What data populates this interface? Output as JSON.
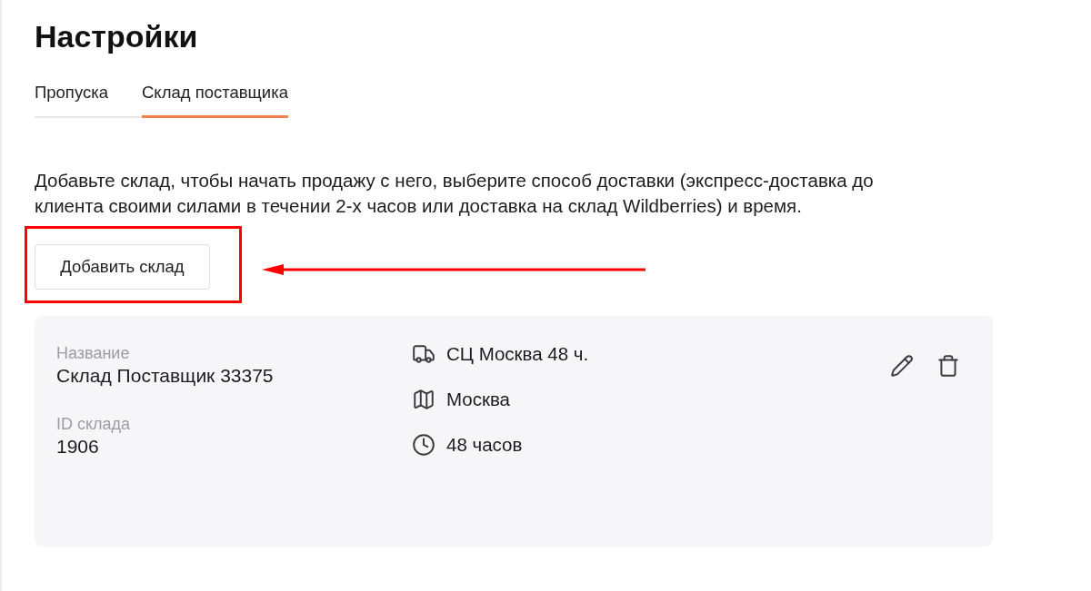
{
  "page": {
    "title": "Настройки"
  },
  "tabs": [
    {
      "label": "Пропуска",
      "selected": false
    },
    {
      "label": "Склад поставщика",
      "selected": true
    }
  ],
  "description": "Добавьте склад, чтобы начать продажу с него, выберите способ доставки (экспресс-доставка до клиента своими силами в течении 2-х часов или доставка на склад Wildberries) и время.",
  "add_button": {
    "label": "Добавить склад",
    "annotated": true
  },
  "warehouses": [
    {
      "fields": [
        {
          "label": "Название",
          "value": "Склад Поставщик 33375"
        },
        {
          "label": "ID склада",
          "value": "1906"
        }
      ],
      "details": [
        {
          "kind": "delivery",
          "text": "СЦ Москва 48 ч."
        },
        {
          "kind": "city",
          "text": "Москва"
        },
        {
          "kind": "time",
          "text": "48 часов"
        }
      ]
    }
  ]
}
